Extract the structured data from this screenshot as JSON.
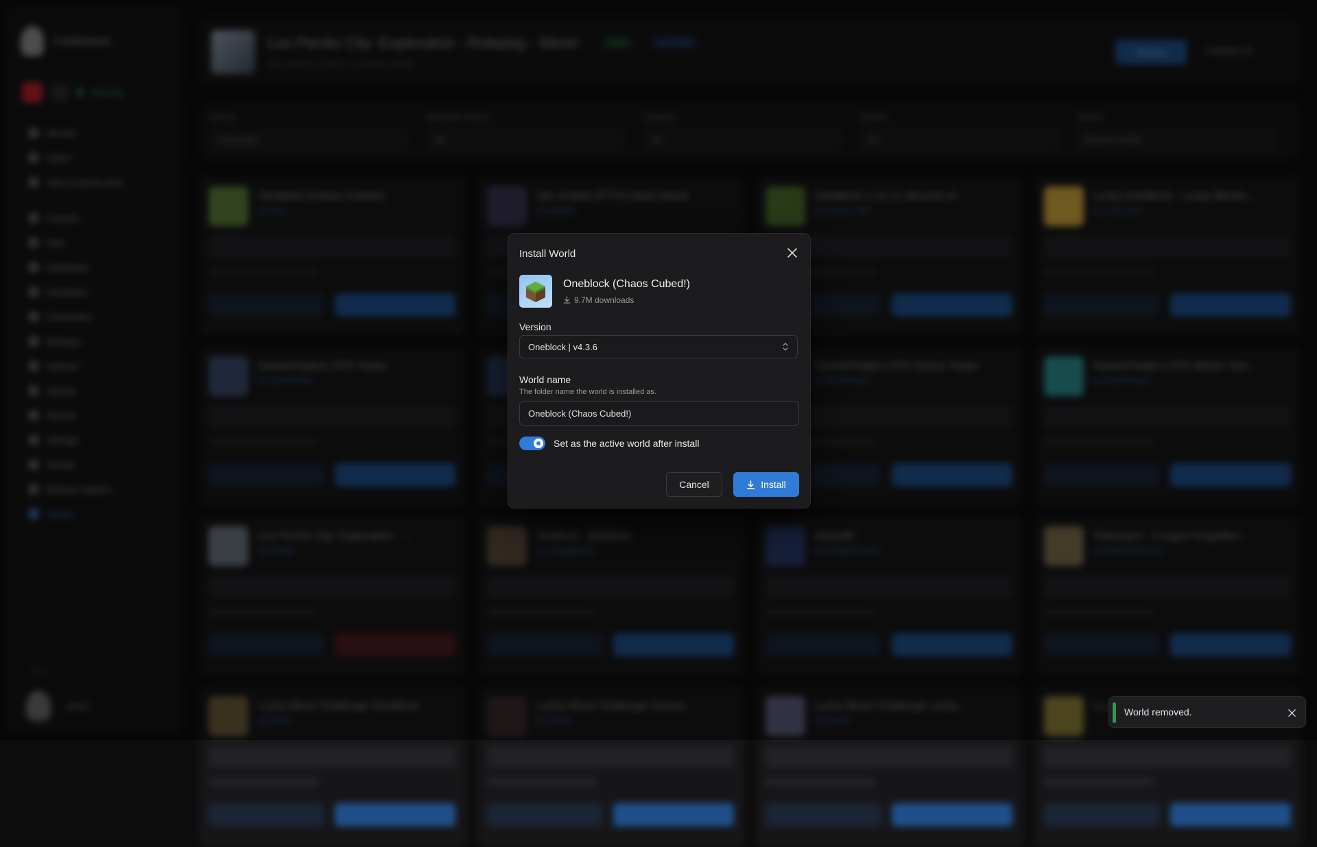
{
  "app": {
    "brand": "Cobblestone",
    "server_status": "Running",
    "nav": [
      {
        "label": "Servers"
      },
      {
        "label": "Admin"
      },
      {
        "label": "View in Admin Area"
      },
      {
        "label": "Console"
      },
      {
        "label": "Files"
      },
      {
        "label": "Databases"
      },
      {
        "label": "Schedules"
      },
      {
        "label": "Consumers"
      },
      {
        "label": "Backups"
      },
      {
        "label": "Network"
      },
      {
        "label": "Startup"
      },
      {
        "label": "Mounts"
      },
      {
        "label": "Settings"
      },
      {
        "label": "Activity"
      },
      {
        "label": "Bedrock Addons"
      },
      {
        "label": "Worlds"
      }
    ],
    "sidebar_footer_label": "Admin",
    "user_name": "admin",
    "header": {
      "title": "Los Perrito City: Exploration - Roleplay - More!",
      "subtitle": "The world you select is currently running",
      "badge_active": "active",
      "badge_java": "java-edition",
      "browse_label": "Browse",
      "installed_label": "Installed (2)"
    },
    "filters": [
      {
        "label": "Sort by",
        "value": "Popularity"
      },
      {
        "label": "Minecraft Version",
        "value": "All"
      },
      {
        "label": "Category",
        "value": "All"
      },
      {
        "label": "Results",
        "value": "25"
      },
      {
        "label": "Search",
        "value": "Search worlds"
      }
    ],
    "cards": [
      {
        "title": "Oneblock (Chaos Cubed!)",
        "author": "by Clew"
      },
      {
        "title": "Isle of Bork ATTYO Bark Island",
        "author": "by Leomalt"
      },
      {
        "title": "OneBlock 1.21.11 (Mounts of ...",
        "author": "by Chaotic_Wild"
      },
      {
        "title": "Lucky OneBlock - Lucky Blocks ...",
        "author": "by Lucky_Man"
      },
      {
        "title": "GamerPotato's FPS Tester",
        "author": "by GamerPotato"
      },
      {
        "title": "",
        "author": ""
      },
      {
        "title": "GamerPotato's FPS Stress Tester",
        "author": "by GamerPotato"
      },
      {
        "title": "GamerPotato's FPS Winter Sho...",
        "author": "by GamerPotato"
      },
      {
        "title": "Los Perrito City: Exploration - ...",
        "author": "by Lilistafix"
      },
      {
        "title": "Voidlock - Skyblock",
        "author": "by Lukeagakushi"
      },
      {
        "title": "Aesynth",
        "author": "by DriftingHorizonic"
      },
      {
        "title": "Tidewatch - A super Forgotten...",
        "author": "by WaterWizardLeet"
      },
      {
        "title": "Lucky Block Challenge OneBlock",
        "author": "by Solvent"
      },
      {
        "title": "Lucky Block Challenge Games",
        "author": "by Solvent"
      },
      {
        "title": "Lucky Block Challenge Lucky...",
        "author": "by Solvent"
      },
      {
        "title": "Lu...",
        "author": ""
      }
    ]
  },
  "modal": {
    "title": "Install World",
    "world_name": "Oneblock (Chaos Cubed!)",
    "downloads": "9.7M downloads",
    "version_label": "Version",
    "version_value": "Oneblock | v4.3.6",
    "world_name_label": "World name",
    "world_name_help": "The folder name the world is installed as.",
    "world_name_value": "Oneblock (Chaos Cubed!)",
    "toggle_label": "Set as the active world after install",
    "toggle_on": true,
    "cancel_label": "Cancel",
    "install_label": "Install"
  },
  "toast": {
    "message": "World removed.",
    "color": "#2e9a4e"
  },
  "colors": {
    "accent": "#2f7bd8",
    "background": "#0d0d0e",
    "modal_bg": "#1c1c1e"
  }
}
